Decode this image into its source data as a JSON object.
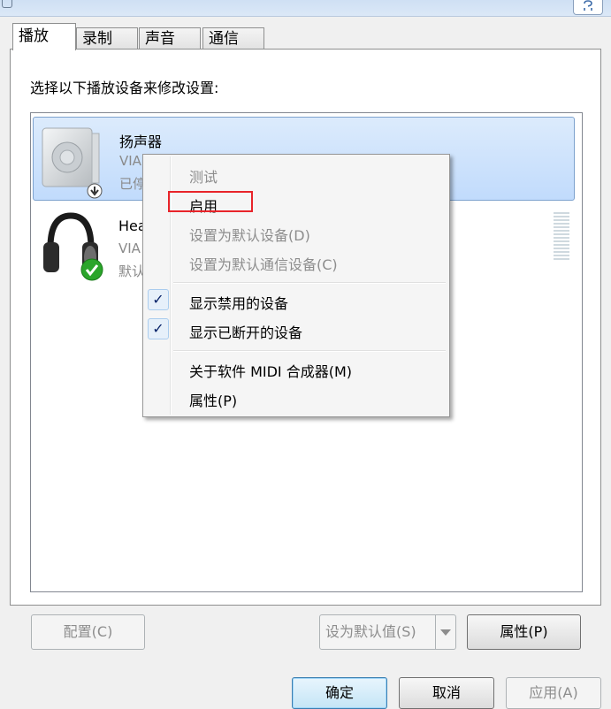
{
  "tabs": [
    {
      "label": "播放"
    },
    {
      "label": "录制"
    },
    {
      "label": "声音"
    },
    {
      "label": "通信"
    }
  ],
  "instruction": "选择以下播放设备来修改设置:",
  "devices": [
    {
      "name": "扬声器",
      "sub1": "VIA HD Audio",
      "sub2": "已停用",
      "icon": "speaker-icon",
      "status_icon": "disabled-arrow-icon",
      "selected": true
    },
    {
      "name": "Hea",
      "sub1": "VIA",
      "sub2": "默认",
      "icon": "headphones-icon",
      "status_icon": "default-check-icon",
      "selected": false
    }
  ],
  "context_menu": {
    "items": [
      {
        "label": "测试",
        "enabled": false
      },
      {
        "label": "启用",
        "enabled": true
      },
      {
        "label": "设置为默认设备(D)",
        "enabled": false
      },
      {
        "label": "设置为默认通信设备(C)",
        "enabled": false
      },
      {
        "label": "显示禁用的设备",
        "enabled": true,
        "checked": true
      },
      {
        "label": "显示已断开的设备",
        "enabled": true,
        "checked": true
      },
      {
        "label": "关于软件 MIDI 合成器(M)",
        "enabled": true
      },
      {
        "label": "属性(P)",
        "enabled": true
      }
    ],
    "check_glyph": "✓",
    "highlight_color": "#e8242a"
  },
  "buttons": {
    "configure": "配置(C)",
    "set_default": "设为默认值(S)",
    "properties": "属性(P)",
    "ok": "确定",
    "cancel": "取消",
    "apply": "应用(A)"
  },
  "titlebar": {
    "help_glyph": "? ͡"
  },
  "colors": {
    "selection": "#c1dbfc",
    "default_check": "#2aa52a"
  }
}
